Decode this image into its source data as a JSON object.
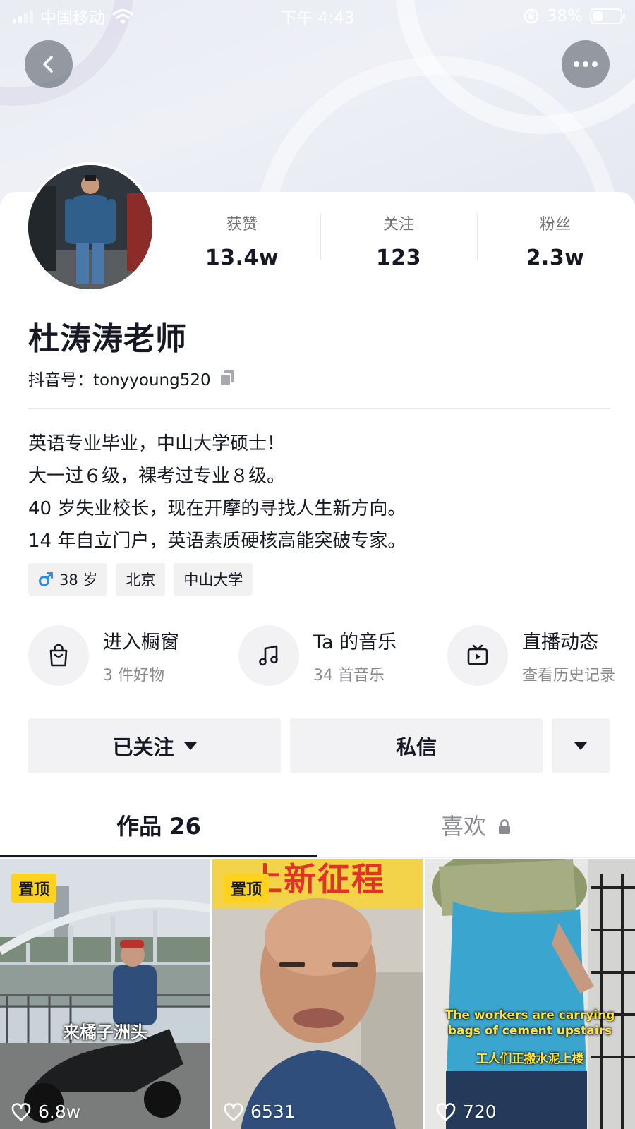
{
  "status_bar": {
    "carrier": "中国移动",
    "time": "下午 4:43",
    "battery": "38%",
    "battery_level": 0.38
  },
  "nav": {
    "back_icon": "chevron-left-icon",
    "more_icon": "more-horizontal-icon"
  },
  "profile": {
    "stats": [
      {
        "label": "获赞",
        "value": "13.4w"
      },
      {
        "label": "关注",
        "value": "123"
      },
      {
        "label": "粉丝",
        "value": "2.3w"
      }
    ],
    "name": "杜涛涛老师",
    "douyin_id": "抖音号：tonyyoung520",
    "bio": [
      "英语专业毕业，中山大学硕士！",
      "大一过６级，裸考过专业８级。",
      "40 岁失业校长，现在开摩的寻找人生新方向。",
      "14 年自立门户，英语素质硬核高能突破专家。"
    ],
    "tags": {
      "age": "38 岁",
      "city": "北京",
      "school": "中山大学",
      "gender_icon": "male-icon",
      "gender_color": "#2a8cf0"
    }
  },
  "entries": [
    {
      "title": "进入橱窗",
      "subtitle": "3 件好物",
      "icon": "shopping-bag-icon"
    },
    {
      "title": "Ta 的音乐",
      "subtitle": "34 首音乐",
      "icon": "music-note-icon"
    },
    {
      "title": "直播动态",
      "subtitle": "查看历史记录",
      "icon": "tv-play-icon"
    }
  ],
  "actions": {
    "follow_label": "已关注",
    "message_label": "私信"
  },
  "tabs": {
    "works": "作品 26",
    "likes": "喜欢"
  },
  "videos": [
    {
      "pinned": "置顶",
      "caption": "来橘子洲头",
      "likes": "6.8w"
    },
    {
      "pinned": "置顶",
      "banner": "上新征程",
      "likes": "6531"
    },
    {
      "caption_en": "The workers are carrying bags of cement upstairs",
      "caption_zh": "工人们正搬水泥上楼",
      "likes": "720"
    }
  ],
  "colors": {
    "accent_yellow": "#ffd21e",
    "text_primary": "#161823",
    "text_secondary": "#8a8b91"
  }
}
